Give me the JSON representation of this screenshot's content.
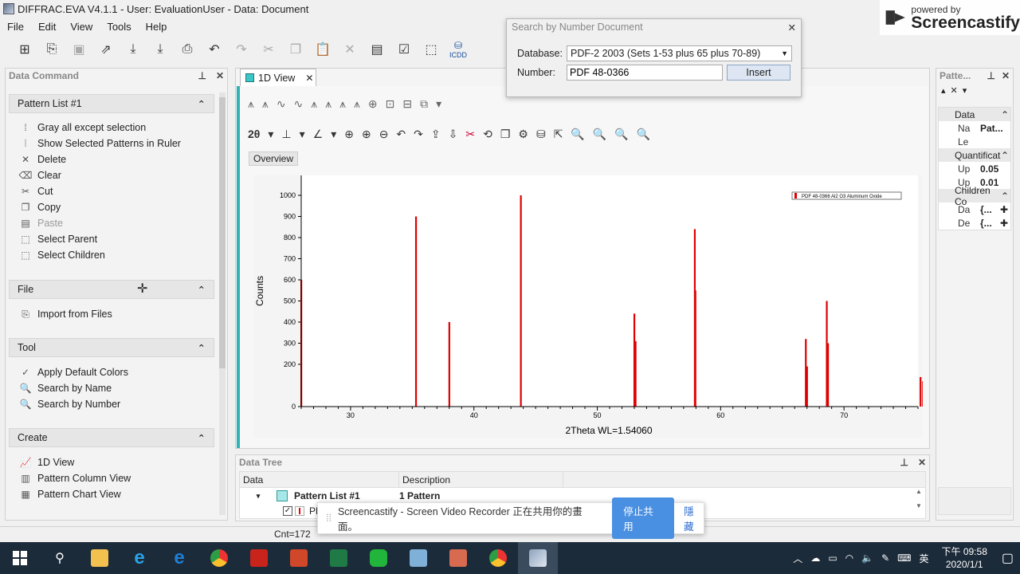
{
  "window": {
    "title": "DIFFRAC.EVA V4.1.1 - User: EvaluationUser - Data: Document"
  },
  "menu": [
    "File",
    "Edit",
    "View",
    "Tools",
    "Help"
  ],
  "toolbar": {
    "icdd_label": "ICDD"
  },
  "left_panel": {
    "title": "Data Command",
    "pattern_list": {
      "header": "Pattern List #1",
      "items": [
        {
          "label": "Gray all except selection",
          "icon": "gray-icon",
          "enabled": true
        },
        {
          "label": "Show Selected Patterns in Ruler",
          "icon": "ruler-icon",
          "enabled": true
        },
        {
          "label": "Delete",
          "icon": "delete-icon",
          "enabled": true
        },
        {
          "label": "Clear",
          "icon": "eraser-icon",
          "enabled": true
        },
        {
          "label": "Cut",
          "icon": "cut-icon",
          "enabled": true
        },
        {
          "label": "Copy",
          "icon": "copy-icon",
          "enabled": true
        },
        {
          "label": "Paste",
          "icon": "paste-icon",
          "enabled": false
        },
        {
          "label": "Select Parent",
          "icon": "select-parent-icon",
          "enabled": true
        },
        {
          "label": "Select Children",
          "icon": "select-children-icon",
          "enabled": true
        }
      ]
    },
    "file": {
      "header": "File",
      "items": [
        {
          "label": "Import from Files",
          "icon": "import-icon"
        }
      ]
    },
    "tool": {
      "header": "Tool",
      "items": [
        {
          "label": "Apply Default Colors",
          "icon": "colors-icon"
        },
        {
          "label": "Search by Name",
          "icon": "search-name-icon"
        },
        {
          "label": "Search by Number",
          "icon": "search-number-icon"
        }
      ]
    },
    "create": {
      "header": "Create",
      "items": [
        {
          "label": "1D View",
          "icon": "1d-view-icon"
        },
        {
          "label": "Pattern Column View",
          "icon": "column-view-icon"
        },
        {
          "label": "Pattern Chart View",
          "icon": "chart-view-icon"
        }
      ]
    }
  },
  "view_tab": {
    "label": "1D View"
  },
  "overview_label": "Overview",
  "toolbar_2theta": "2θ",
  "chart_data": {
    "type": "bar",
    "xlabel": "2Theta WL=1.54060",
    "ylabel": "Counts",
    "xlim": [
      26,
      76
    ],
    "ylim": [
      0,
      1000
    ],
    "x_ticks": [
      30,
      40,
      50,
      60,
      70
    ],
    "y_ticks": [
      0,
      200,
      300,
      400,
      500,
      600,
      700,
      800,
      900,
      1000
    ],
    "legend": "PDF 48-0366 Al2 O3 Aluminum Oxide",
    "series": [
      {
        "name": "PDF 48-0366 Al2 O3 Aluminum Oxide",
        "color": "#e00000",
        "x": [
          26.0,
          35.3,
          38.0,
          43.8,
          53.0,
          53.1,
          57.9,
          57.95,
          66.9,
          67.0,
          68.6,
          68.7,
          76.2,
          76.4
        ],
        "y": [
          600,
          900,
          400,
          1000,
          440,
          310,
          840,
          550,
          320,
          190,
          500,
          300,
          140,
          120
        ]
      }
    ]
  },
  "right_panel": {
    "title": "Patte...",
    "rows": [
      {
        "label": "Data",
        "value": "",
        "type": "group"
      },
      {
        "label": "Na",
        "value": "Pat...",
        "type": "row"
      },
      {
        "label": "Le",
        "value": "",
        "type": "row"
      },
      {
        "label": "Quantificat",
        "value": "",
        "type": "group"
      },
      {
        "label": "Up",
        "value": "0.05",
        "type": "row"
      },
      {
        "label": "Up",
        "value": "0.01",
        "type": "row"
      },
      {
        "label": "Children Co",
        "value": "",
        "type": "group"
      },
      {
        "label": "Da",
        "value": "{...",
        "type": "row"
      },
      {
        "label": "De",
        "value": "{...",
        "type": "row"
      }
    ]
  },
  "data_tree": {
    "title": "Data Tree",
    "columns": [
      "Data",
      "Description"
    ],
    "rows": [
      {
        "name": "Pattern List #1",
        "desc": "1 Pattern"
      },
      {
        "name": "PD",
        "desc": ""
      }
    ]
  },
  "status": {
    "count": "Cnt=172"
  },
  "dialog": {
    "title": "Search by Number Document",
    "database_label": "Database:",
    "database_value": "PDF-2 2003 (Sets 1-53 plus 65 plus 70-89)",
    "number_label": "Number:",
    "number_value": "PDF 48-0366",
    "insert": "Insert"
  },
  "notification": {
    "text": "Screencastify - Screen Video Recorder 正在共用你的畫面。",
    "stop": "停止共用",
    "hide": "隱藏"
  },
  "watermark": {
    "powered": "powered by",
    "brand": "Screencastify"
  },
  "tray": {
    "ime": "英",
    "time": "下午 09:58",
    "date": "2020/1/1"
  }
}
